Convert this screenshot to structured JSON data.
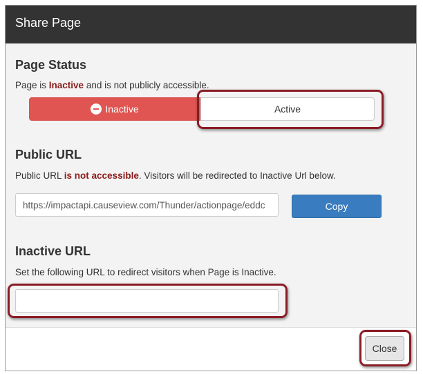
{
  "modal": {
    "title": "Share Page"
  },
  "page_status": {
    "heading": "Page Status",
    "text_prefix": "Page is ",
    "status_word": "Inactive",
    "text_suffix": " and is not publicly accessible.",
    "inactive_label": "Inactive",
    "active_label": "Active",
    "inactive_color": "#e05551"
  },
  "public_url": {
    "heading": "Public URL",
    "text_prefix": "Public URL ",
    "status_phrase": "is not accessible",
    "text_suffix": ". Visitors will be redirected to Inactive Url below.",
    "value": "https://impactapi.causeview.com/Thunder/actionpage/eddc",
    "copy_label": "Copy",
    "copy_color": "#3a7cc0"
  },
  "inactive_url": {
    "heading": "Inactive URL",
    "help": "Set the following URL to redirect visitors when Page is Inactive.",
    "value": ""
  },
  "footer": {
    "close_label": "Close"
  },
  "annotation_color": "#8a1c24"
}
